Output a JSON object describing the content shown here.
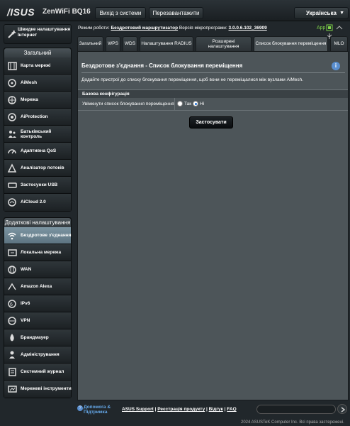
{
  "header": {
    "brand": "/ISUS",
    "model": "ZenWiFi BQ16",
    "logout_label": "Вихід з системи",
    "reboot_label": "Перезавантажити",
    "language": "Українська"
  },
  "status": {
    "mode_prefix": "Режим роботи:",
    "mode_value": "Бездротовий маршрутизатор",
    "fw_prefix": "Версія мікропрограми:",
    "fw_value": "3.0.0.6.102_36909",
    "app_label": "App"
  },
  "sidebar": {
    "quick_setup": "Швидке налаштування Інтернет",
    "general_heading": "Загальний",
    "general_items": [
      {
        "label": "Карта мережі",
        "icon": "map-icon"
      },
      {
        "label": "AiMesh",
        "icon": "aimesh-icon"
      },
      {
        "label": "Мережа",
        "icon": "network-icon"
      },
      {
        "label": "AiProtection",
        "icon": "shield-icon"
      },
      {
        "label": "Батьківський контроль",
        "icon": "family-icon"
      },
      {
        "label": "Адаптивна QoS",
        "icon": "gauge-icon"
      },
      {
        "label": "Аналізатор потоків",
        "icon": "analyzer-icon"
      },
      {
        "label": "Застосунки USB",
        "icon": "usb-icon"
      },
      {
        "label": "AiCloud 2.0",
        "icon": "cloud-icon"
      }
    ],
    "advanced_heading": "Додаткові налаштування",
    "advanced_items": [
      {
        "label": "Бездротове з'єднання",
        "icon": "wifi-icon"
      },
      {
        "label": "Локальна мережа",
        "icon": "lan-icon"
      },
      {
        "label": "WAN",
        "icon": "globe-icon"
      },
      {
        "label": "Amazon Alexa",
        "icon": "alexa-icon"
      },
      {
        "label": "IPv6",
        "icon": "ipv6-icon"
      },
      {
        "label": "VPN",
        "icon": "vpn-icon"
      },
      {
        "label": "Брандмауер",
        "icon": "firewall-icon"
      },
      {
        "label": "Адміністрування",
        "icon": "admin-icon"
      },
      {
        "label": "Системний журнал",
        "icon": "log-icon"
      },
      {
        "label": "Мережеві інструменти",
        "icon": "tools-icon"
      }
    ]
  },
  "tabs": [
    "Загальний",
    "WPS",
    "WDS",
    "Налаштування RADIUS",
    "Розширені налаштування",
    "Список блокування переміщення",
    "MLO"
  ],
  "main": {
    "title": "Бездротове з'єднання - Список блокування переміщення",
    "description": "Додайте пристрої до списку блокування переміщення, щоб вони не переміщалися між вузлами AiMesh.",
    "section_heading": "Базова конфігурація",
    "enable_label": "Увімкнути список блокування переміщення",
    "yes_label": "Так",
    "no_label": "Ні",
    "selected": "Ні",
    "apply_label": "Застосувати"
  },
  "footer": {
    "help_support": "Допомога & Підтримка",
    "asus_support": "ASUS Support",
    "product_reg": "Реєстрація продукту",
    "feedback": "Відгук",
    "faq": "FAQ",
    "copyright": "2024 ASUSTeK Computer Inc. Всі права застережені."
  },
  "colors": {
    "accent_blue": "#65a8e9",
    "active_item": "#6e8794",
    "app_green": "#7fd34a"
  }
}
